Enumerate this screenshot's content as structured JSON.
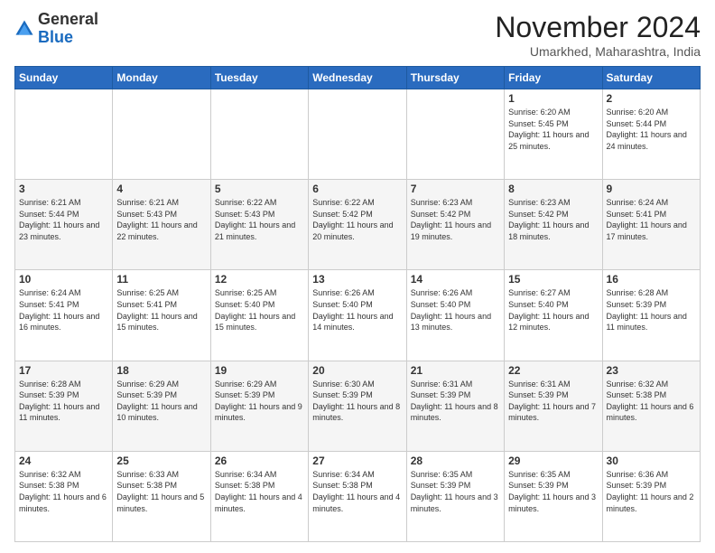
{
  "logo": {
    "general": "General",
    "blue": "Blue"
  },
  "title": "November 2024",
  "location": "Umarkhed, Maharashtra, India",
  "weekdays": [
    "Sunday",
    "Monday",
    "Tuesday",
    "Wednesday",
    "Thursday",
    "Friday",
    "Saturday"
  ],
  "weeks": [
    [
      {
        "day": "",
        "info": ""
      },
      {
        "day": "",
        "info": ""
      },
      {
        "day": "",
        "info": ""
      },
      {
        "day": "",
        "info": ""
      },
      {
        "day": "",
        "info": ""
      },
      {
        "day": "1",
        "info": "Sunrise: 6:20 AM\nSunset: 5:45 PM\nDaylight: 11 hours and 25 minutes."
      },
      {
        "day": "2",
        "info": "Sunrise: 6:20 AM\nSunset: 5:44 PM\nDaylight: 11 hours and 24 minutes."
      }
    ],
    [
      {
        "day": "3",
        "info": "Sunrise: 6:21 AM\nSunset: 5:44 PM\nDaylight: 11 hours and 23 minutes."
      },
      {
        "day": "4",
        "info": "Sunrise: 6:21 AM\nSunset: 5:43 PM\nDaylight: 11 hours and 22 minutes."
      },
      {
        "day": "5",
        "info": "Sunrise: 6:22 AM\nSunset: 5:43 PM\nDaylight: 11 hours and 21 minutes."
      },
      {
        "day": "6",
        "info": "Sunrise: 6:22 AM\nSunset: 5:42 PM\nDaylight: 11 hours and 20 minutes."
      },
      {
        "day": "7",
        "info": "Sunrise: 6:23 AM\nSunset: 5:42 PM\nDaylight: 11 hours and 19 minutes."
      },
      {
        "day": "8",
        "info": "Sunrise: 6:23 AM\nSunset: 5:42 PM\nDaylight: 11 hours and 18 minutes."
      },
      {
        "day": "9",
        "info": "Sunrise: 6:24 AM\nSunset: 5:41 PM\nDaylight: 11 hours and 17 minutes."
      }
    ],
    [
      {
        "day": "10",
        "info": "Sunrise: 6:24 AM\nSunset: 5:41 PM\nDaylight: 11 hours and 16 minutes."
      },
      {
        "day": "11",
        "info": "Sunrise: 6:25 AM\nSunset: 5:41 PM\nDaylight: 11 hours and 15 minutes."
      },
      {
        "day": "12",
        "info": "Sunrise: 6:25 AM\nSunset: 5:40 PM\nDaylight: 11 hours and 15 minutes."
      },
      {
        "day": "13",
        "info": "Sunrise: 6:26 AM\nSunset: 5:40 PM\nDaylight: 11 hours and 14 minutes."
      },
      {
        "day": "14",
        "info": "Sunrise: 6:26 AM\nSunset: 5:40 PM\nDaylight: 11 hours and 13 minutes."
      },
      {
        "day": "15",
        "info": "Sunrise: 6:27 AM\nSunset: 5:40 PM\nDaylight: 11 hours and 12 minutes."
      },
      {
        "day": "16",
        "info": "Sunrise: 6:28 AM\nSunset: 5:39 PM\nDaylight: 11 hours and 11 minutes."
      }
    ],
    [
      {
        "day": "17",
        "info": "Sunrise: 6:28 AM\nSunset: 5:39 PM\nDaylight: 11 hours and 11 minutes."
      },
      {
        "day": "18",
        "info": "Sunrise: 6:29 AM\nSunset: 5:39 PM\nDaylight: 11 hours and 10 minutes."
      },
      {
        "day": "19",
        "info": "Sunrise: 6:29 AM\nSunset: 5:39 PM\nDaylight: 11 hours and 9 minutes."
      },
      {
        "day": "20",
        "info": "Sunrise: 6:30 AM\nSunset: 5:39 PM\nDaylight: 11 hours and 8 minutes."
      },
      {
        "day": "21",
        "info": "Sunrise: 6:31 AM\nSunset: 5:39 PM\nDaylight: 11 hours and 8 minutes."
      },
      {
        "day": "22",
        "info": "Sunrise: 6:31 AM\nSunset: 5:39 PM\nDaylight: 11 hours and 7 minutes."
      },
      {
        "day": "23",
        "info": "Sunrise: 6:32 AM\nSunset: 5:38 PM\nDaylight: 11 hours and 6 minutes."
      }
    ],
    [
      {
        "day": "24",
        "info": "Sunrise: 6:32 AM\nSunset: 5:38 PM\nDaylight: 11 hours and 6 minutes."
      },
      {
        "day": "25",
        "info": "Sunrise: 6:33 AM\nSunset: 5:38 PM\nDaylight: 11 hours and 5 minutes."
      },
      {
        "day": "26",
        "info": "Sunrise: 6:34 AM\nSunset: 5:38 PM\nDaylight: 11 hours and 4 minutes."
      },
      {
        "day": "27",
        "info": "Sunrise: 6:34 AM\nSunset: 5:38 PM\nDaylight: 11 hours and 4 minutes."
      },
      {
        "day": "28",
        "info": "Sunrise: 6:35 AM\nSunset: 5:39 PM\nDaylight: 11 hours and 3 minutes."
      },
      {
        "day": "29",
        "info": "Sunrise: 6:35 AM\nSunset: 5:39 PM\nDaylight: 11 hours and 3 minutes."
      },
      {
        "day": "30",
        "info": "Sunrise: 6:36 AM\nSunset: 5:39 PM\nDaylight: 11 hours and 2 minutes."
      }
    ]
  ]
}
